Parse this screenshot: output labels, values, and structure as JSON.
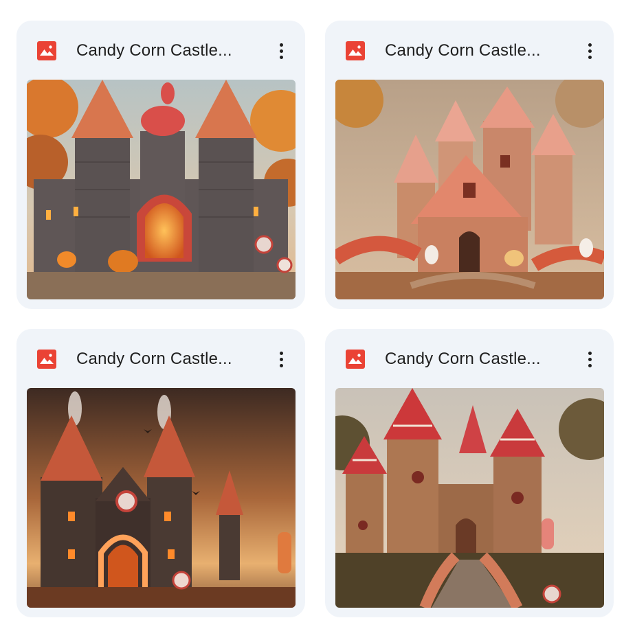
{
  "files": [
    {
      "title": "Candy Corn Castle...",
      "type_icon": "image-file-icon",
      "more_icon": "more-vert-icon",
      "thumbnail_alt": "Candy Corn Castle (1)",
      "palette": {
        "sky": "#c9b9a4",
        "wall": "#5d5656",
        "roof": "#d9744a",
        "glow": "#f28a2e",
        "ground": "#7a5a44"
      }
    },
    {
      "title": "Candy Corn Castle...",
      "type_icon": "image-file-icon",
      "more_icon": "more-vert-icon",
      "thumbnail_alt": "Candy Corn Castle (2)",
      "palette": {
        "sky": "#c8a27c",
        "wall": "#c98a66",
        "roof": "#e7a38d",
        "glow": "#f6d8c4",
        "ground": "#a86a44"
      }
    },
    {
      "title": "Candy Corn Castle...",
      "type_icon": "image-file-icon",
      "more_icon": "more-vert-icon",
      "thumbnail_alt": "Candy Corn Castle (3)",
      "palette": {
        "sky": "#5a3a2a",
        "wall": "#4a3a36",
        "roof": "#c45b38",
        "glow": "#ff8a3a",
        "ground": "#6b3a22"
      }
    },
    {
      "title": "Candy Corn Castle...",
      "type_icon": "image-file-icon",
      "more_icon": "more-vert-icon",
      "thumbnail_alt": "Candy Corn Castle (4)",
      "palette": {
        "sky": "#d8c9b4",
        "wall": "#a4704c",
        "roof": "#c8373a",
        "glow": "#f4e2cc",
        "ground": "#5d4a34"
      }
    }
  ],
  "colors": {
    "card_bg": "#f0f4f9",
    "image_icon_red": "#ea4335",
    "title_text": "#1f1f1f"
  }
}
